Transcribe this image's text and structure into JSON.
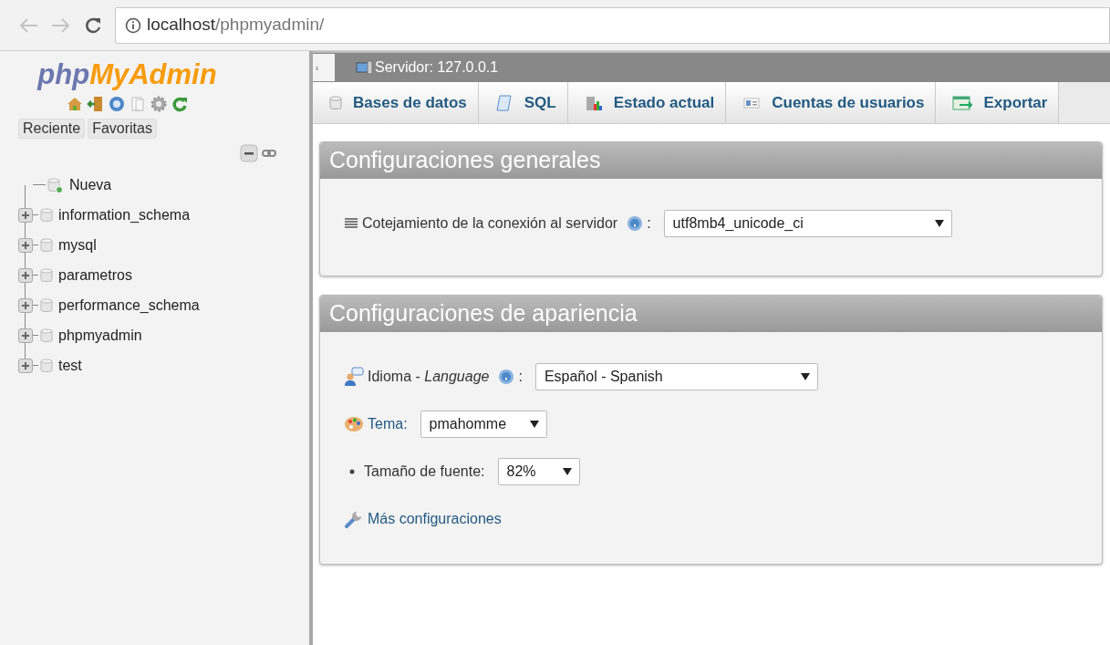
{
  "browser": {
    "url_host": "localhost",
    "url_path": "/phpmyadmin/"
  },
  "sidebar": {
    "logo": [
      "php",
      "MyAdmin"
    ],
    "tabs": [
      {
        "label": "Reciente"
      },
      {
        "label": "Favoritas"
      }
    ],
    "tree": [
      {
        "kind": "new",
        "label": "Nueva"
      },
      {
        "kind": "database",
        "label": "information_schema",
        "expanded": false
      },
      {
        "kind": "database",
        "label": "mysql",
        "expanded": false
      },
      {
        "kind": "database",
        "label": "parametros",
        "expanded": false
      },
      {
        "kind": "database",
        "label": "performance_schema",
        "expanded": false
      },
      {
        "kind": "database",
        "label": "phpmyadmin",
        "expanded": false
      },
      {
        "kind": "database",
        "label": "test",
        "expanded": false
      }
    ]
  },
  "collapse_handle": "‹",
  "breadcrumb": "Servidor: 127.0.0.1",
  "tabs": [
    {
      "kind": "database",
      "label": "Bases de datos"
    },
    {
      "kind": "sql",
      "label": "SQL"
    },
    {
      "kind": "status",
      "label": "Estado actual"
    },
    {
      "kind": "users",
      "label": "Cuentas de usuarios"
    },
    {
      "kind": "export",
      "label": "Exportar"
    }
  ],
  "panels": [
    {
      "title": "Configuraciones generales",
      "rows": [
        {
          "kind": "collation",
          "label": "Cotejamiento de la conexión al servidor",
          "help": true,
          "colon": ":",
          "value": "utf8mb4_unicode_ci"
        }
      ]
    },
    {
      "title": "Configuraciones de apariencia",
      "rows": [
        {
          "kind": "language",
          "label": "Idioma - *Language*",
          "help": true,
          "colon": ":",
          "value": "Español - Spanish"
        },
        {
          "kind": "theme",
          "label": "Tema:",
          "link": true,
          "value": "pmahomme"
        },
        {
          "kind": "font_size",
          "label": "Tamaño de fuente:",
          "value": "82%"
        },
        {
          "kind": "more_settings",
          "label": "Más configuraciones"
        }
      ]
    }
  ]
}
